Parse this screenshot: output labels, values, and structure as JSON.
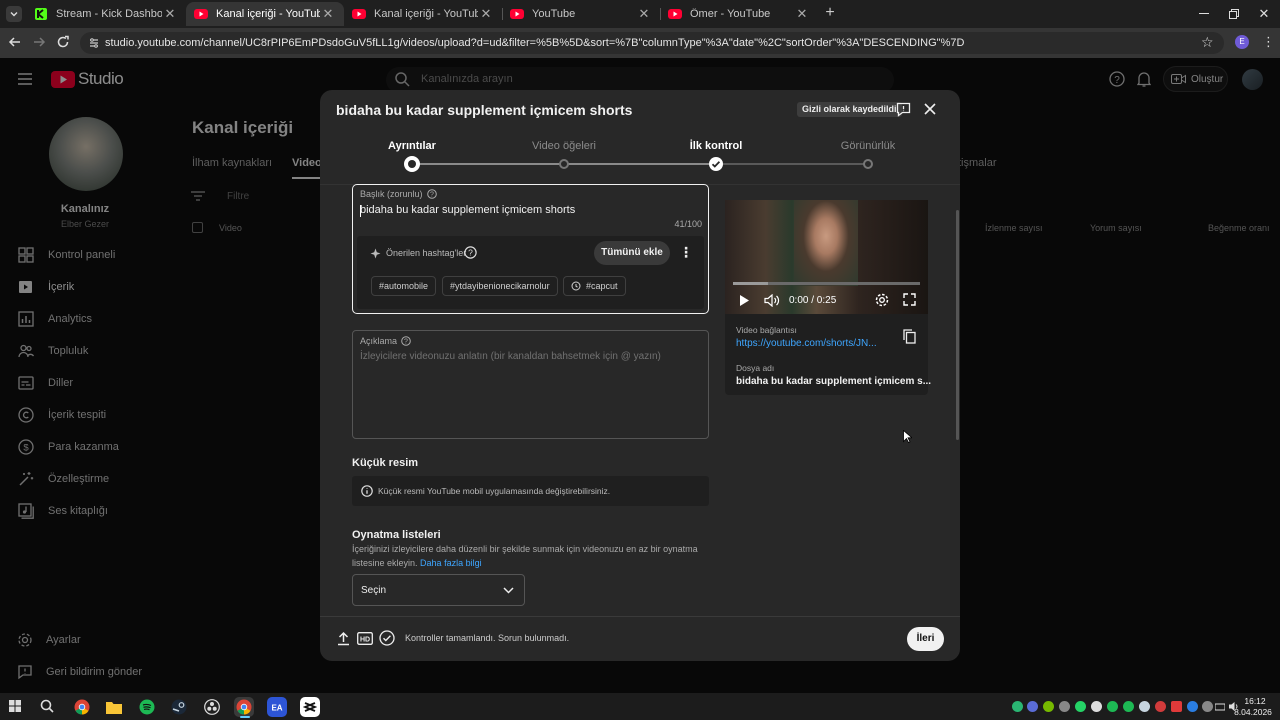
{
  "browser": {
    "tabs": [
      {
        "title": "Stream - Kick Dashboard",
        "active": false
      },
      {
        "title": "Kanal içeriği - YouTube Studio",
        "active": true
      },
      {
        "title": "Kanal içeriği - YouTube Studio",
        "active": false
      },
      {
        "title": "YouTube",
        "active": false
      },
      {
        "title": "Ömer - YouTube",
        "active": false
      }
    ],
    "url": "studio.youtube.com/channel/UC8rPIP6EmPDsdoGuV5fLL1g/videos/upload?d=ud&filter=%5B%5D&sort=%7B\"columnType\"%3A\"date\"%2C\"sortOrder\"%3A\"DESCENDING\"%7D",
    "profile_initial": "E"
  },
  "studio": {
    "logo_text": "Studio",
    "search_placeholder": "Kanalınızda arayın",
    "create_label": "Oluştur",
    "channel_title": "Kanalınız",
    "channel_name": "Elber Gezer",
    "page_title": "Kanal içeriği",
    "tabs": [
      "İlham kaynakları",
      "Videol",
      "tişmalar"
    ],
    "filter_placeholder": "Filtre",
    "table_headers": [
      "Video",
      "İzlenme sayısı",
      "Yorum sayısı",
      "Beğenme oranı"
    ],
    "sidebar": [
      {
        "label": "Kontrol paneli",
        "icon": "dashboard-icon"
      },
      {
        "label": "İçerik",
        "icon": "content-icon"
      },
      {
        "label": "Analytics",
        "icon": "analytics-icon"
      },
      {
        "label": "Topluluk",
        "icon": "community-icon"
      },
      {
        "label": "Diller",
        "icon": "subtitles-icon"
      },
      {
        "label": "İçerik tespiti",
        "icon": "copyright-icon"
      },
      {
        "label": "Para kazanma",
        "icon": "dollar-icon"
      },
      {
        "label": "Özelleştirme",
        "icon": "magic-wand-icon"
      },
      {
        "label": "Ses kitaplığı",
        "icon": "audio-library-icon"
      }
    ],
    "sidebar_bottom": [
      {
        "label": "Ayarlar",
        "icon": "settings-icon"
      },
      {
        "label": "Geri bildirim gönder",
        "icon": "feedback-icon"
      }
    ]
  },
  "modal": {
    "title": "bidaha bu kadar supplement içmicem shorts",
    "saved_badge": "Gizli olarak kaydedildi",
    "steps": [
      {
        "label": "Ayrıntılar",
        "state": "current"
      },
      {
        "label": "Video öğeleri",
        "state": "pending"
      },
      {
        "label": "İlk kontrol",
        "state": "done"
      },
      {
        "label": "Görünürlük",
        "state": "pending"
      }
    ],
    "title_field": {
      "label": "Başlık (zorunlu)",
      "value": "bidaha bu kadar supplement içmicem shorts",
      "counter": "41/100"
    },
    "hashtags": {
      "label": "Önerilen hashtag'ler",
      "add_all": "Tümünü ekle",
      "chips": [
        "#automobile",
        "#ytdayibenionecikarnolur",
        "#capcut"
      ]
    },
    "description": {
      "label": "Açıklama",
      "placeholder": "İzleyicilere videonuzu anlatın (bir kanaldan bahsetmek için @ yazın)"
    },
    "thumbnail": {
      "heading": "Küçük resim",
      "info": "Küçük resmi YouTube mobil uygulamasında değiştirebilirsiniz."
    },
    "playlists": {
      "heading": "Oynatma listeleri",
      "text": "İçeriğinizi izleyicilere daha düzenli bir şekilde sunmak için videonuzu en az bir oynatma listesine ekleyin.",
      "link": "Daha fazla bilgi",
      "select_value": "Seçin"
    },
    "video": {
      "time": "0:00 / 0:25",
      "progress": 0.0,
      "link_label": "Video bağlantısı",
      "link": "https://youtube.com/shorts/JN...",
      "filename_label": "Dosya adı",
      "filename": "bidaha bu kadar supplement içmicem s..."
    },
    "footer": {
      "status": "Kontroller tamamlandı. Sorun bulunmadı.",
      "next": "İleri"
    }
  },
  "taskbar": {
    "time": "16:12",
    "date": "8.04.2026"
  },
  "colors": {
    "accent_link": "#3ea6ff",
    "youtube_red": "#ff0033",
    "modal_bg": "#282828",
    "page_bg": "#0f0f0f"
  }
}
